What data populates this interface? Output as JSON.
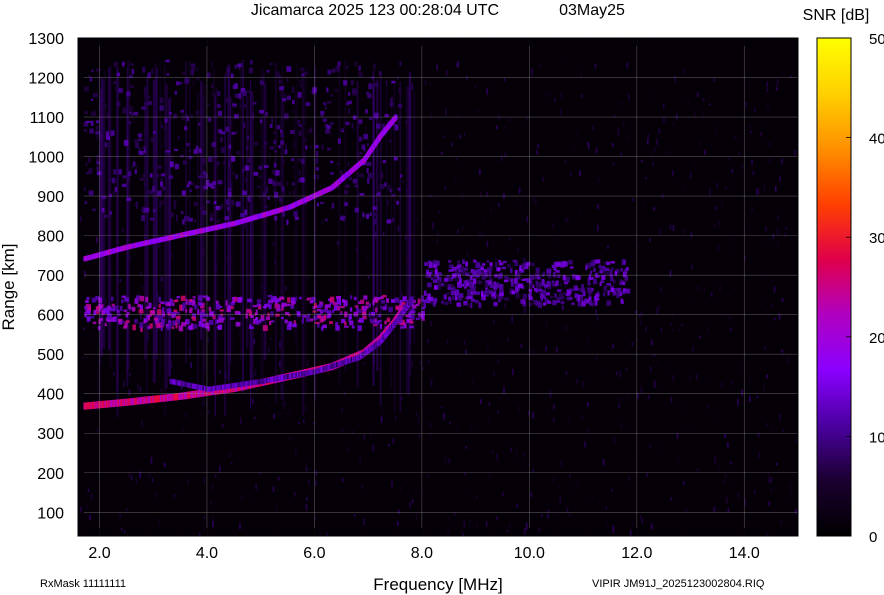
{
  "header": {
    "title": "Jicamarca 2025 123 00:28:04 UTC",
    "date": "03May25"
  },
  "footer": {
    "rxmask": "RxMask 11111111",
    "file": "VIPIR  JM91J_2025123002804.RIQ"
  },
  "chart_data": {
    "type": "heatmap",
    "title": "Jicamarca 2025 123 00:28:04 UTC",
    "xlabel": "Frequency [MHz]",
    "ylabel": "Range [km]",
    "xlim": [
      1.6,
      15.0
    ],
    "ylim": [
      40,
      1300
    ],
    "data_range_max": 1245,
    "x_ticks": [
      2.0,
      4.0,
      6.0,
      8.0,
      10.0,
      12.0,
      14.0
    ],
    "x_tick_labels": [
      "2.0",
      "4.0",
      "6.0",
      "8.0",
      "10.0",
      "12.0",
      "14.0"
    ],
    "y_ticks": [
      100,
      200,
      300,
      400,
      500,
      600,
      700,
      800,
      900,
      1000,
      1100,
      1200,
      1300
    ],
    "y_tick_labels": [
      "100",
      "200",
      "300",
      "400",
      "500",
      "600",
      "700",
      "800",
      "900",
      "1000",
      "1100",
      "1200",
      "1300"
    ],
    "grid": true,
    "colorbar": {
      "label": "SNR [dB]",
      "min": 0,
      "max": 50,
      "ticks": [
        0,
        10,
        20,
        30,
        40,
        50
      ],
      "tick_labels": [
        "0",
        "10",
        "20",
        "30",
        "40",
        "50"
      ],
      "colormap": [
        "#000000",
        "#1a0030",
        "#4b00a0",
        "#8a00ff",
        "#b000c0",
        "#e0004a",
        "#ff4000",
        "#ff9000",
        "#ffd000",
        "#ffff00"
      ]
    },
    "traces": [
      {
        "name": "F-layer ordinary trace",
        "points": [
          [
            1.7,
            370
          ],
          [
            2.5,
            380
          ],
          [
            3.5,
            395
          ],
          [
            4.5,
            415
          ],
          [
            5.5,
            445
          ],
          [
            6.3,
            470
          ],
          [
            6.9,
            505
          ],
          [
            7.2,
            540
          ],
          [
            7.45,
            580
          ],
          [
            7.6,
            610
          ]
        ]
      },
      {
        "name": "F-layer second hop",
        "points": [
          [
            1.7,
            740
          ],
          [
            2.5,
            770
          ],
          [
            3.5,
            800
          ],
          [
            4.5,
            830
          ],
          [
            5.5,
            870
          ],
          [
            6.3,
            920
          ],
          [
            6.9,
            990
          ],
          [
            7.2,
            1050
          ],
          [
            7.5,
            1100
          ]
        ]
      },
      {
        "name": "F-layer faint trace",
        "points": [
          [
            3.3,
            430
          ],
          [
            4.0,
            410
          ],
          [
            5.0,
            430
          ],
          [
            6.0,
            455
          ],
          [
            6.8,
            490
          ],
          [
            7.2,
            530
          ],
          [
            7.55,
            590
          ],
          [
            7.8,
            640
          ]
        ]
      }
    ],
    "bands": [
      {
        "name": "spread echo band",
        "x_range": [
          1.7,
          8.0
        ],
        "y_range": [
          570,
          650
        ],
        "snr": 22
      },
      {
        "name": "extended spread",
        "x_range": [
          8.0,
          11.8
        ],
        "y_range": [
          630,
          740
        ],
        "snr": 14
      },
      {
        "name": "upper diffuse region",
        "x_range": [
          1.7,
          7.6
        ],
        "y_range": [
          840,
          1245
        ],
        "snr": 11
      }
    ]
  }
}
